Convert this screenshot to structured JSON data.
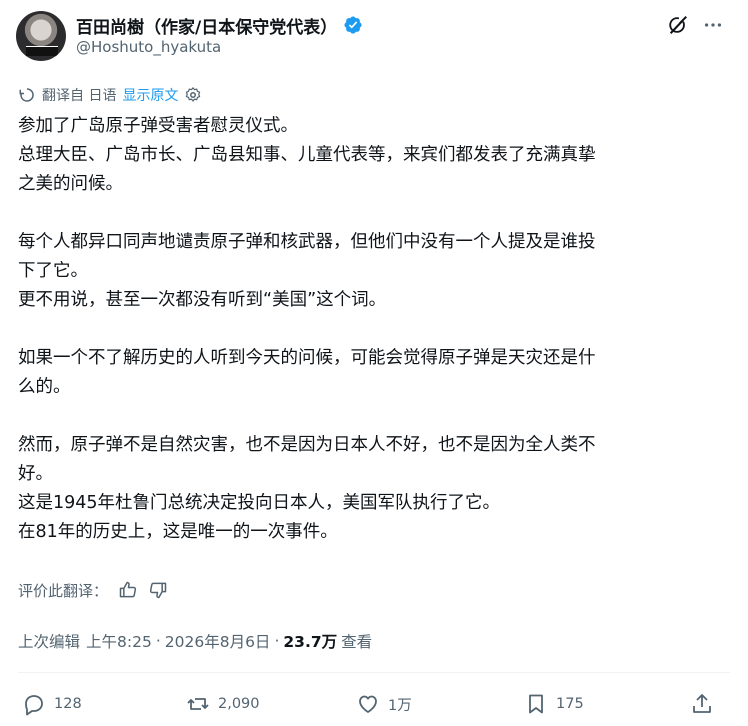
{
  "author": {
    "display_name": "百田尚樹（作家/日本保守党代表）",
    "handle": "@Hoshuto_hyakuta"
  },
  "icons": {
    "verified": "verified-badge-icon",
    "grok": "grok-icon",
    "more": "more-icon"
  },
  "colors": {
    "accent": "#1d9bf0",
    "text": "#0f1419",
    "secondary": "#536471"
  },
  "translation": {
    "label": "翻译自 日语",
    "show_original": "显示原文"
  },
  "tweet": {
    "lines": [
      "参加了广岛原子弹受害者慰灵仪式。",
      "总理大臣、广岛市长、广岛县知事、儿童代表等，来宾们都发表了充满真挚",
      "之美的问候。",
      "",
      "每个人都异口同声地谴责原子弹和核武器，但他们中没有一个人提及是谁投",
      "下了它。",
      "更不用说，甚至一次都没有听到“美国”这个词。",
      "",
      "如果一个不了解历史的人听到今天的问候，可能会觉得原子弹是天灾还是什",
      "么的。",
      "",
      "然而，原子弹不是自然灾害，也不是因为日本人不好，也不是因为全人类不",
      "好。",
      "这是1945年杜鲁门总统决定投向日本人，美国军队执行了它。",
      "在81年的历史上，这是唯一的一次事件。"
    ]
  },
  "rating": {
    "label": "评价此翻译："
  },
  "meta": {
    "edited": "上次编辑",
    "time": "上午8:25",
    "date": "2026年8月6日",
    "views_count": "23.7万",
    "views_label": "查看"
  },
  "actions": {
    "replies": "128",
    "reposts": "2,090",
    "likes": "1万",
    "bookmarks": "175"
  }
}
